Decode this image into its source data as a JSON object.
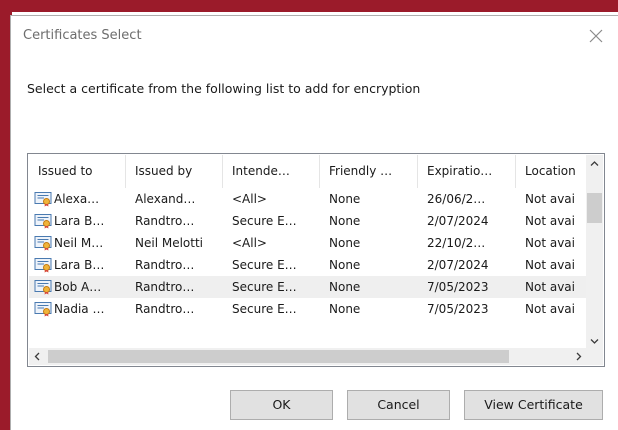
{
  "dialog": {
    "title": "Certificates Select",
    "instruction": "Select a certificate from the following list to add for encryption"
  },
  "colors": {
    "accent": "#9b1b2a",
    "selected_row": "#efefef",
    "button": "#e1e1e1"
  },
  "table": {
    "columns": [
      "Issued to",
      "Issued by",
      "Intende…",
      "Friendly …",
      "Expiratio…",
      "Location"
    ],
    "rows": [
      {
        "issued_to": "Alexa…",
        "issued_by": "Alexand…",
        "intended": "<All>",
        "friendly": "None",
        "expiration": "26/06/2…",
        "location": "Not avai"
      },
      {
        "issued_to": "Lara B…",
        "issued_by": "Randtro…",
        "intended": "Secure E…",
        "friendly": "None",
        "expiration": "2/07/2024",
        "location": "Not avai"
      },
      {
        "issued_to": "Neil M…",
        "issued_by": "Neil Melotti",
        "intended": "<All>",
        "friendly": "None",
        "expiration": "22/10/2…",
        "location": "Not avai"
      },
      {
        "issued_to": "Lara B…",
        "issued_by": "Randtro…",
        "intended": "Secure E…",
        "friendly": "None",
        "expiration": "2/07/2024",
        "location": "Not avai"
      },
      {
        "issued_to": "Bob A…",
        "issued_by": "Randtro…",
        "intended": "Secure E…",
        "friendly": "None",
        "expiration": "7/05/2023",
        "location": "Not avai"
      },
      {
        "issued_to": "Nadia …",
        "issued_by": "Randtro…",
        "intended": "Secure E…",
        "friendly": "None",
        "expiration": "7/05/2023",
        "location": "Not avai"
      }
    ],
    "selected_index": 4
  },
  "buttons": {
    "ok": "OK",
    "cancel": "Cancel",
    "view_certificate": "View Certificate"
  },
  "icons": {
    "close": "close-icon",
    "row": "certificate-icon",
    "scroll_up": "chevron-up-icon",
    "scroll_down": "chevron-down-icon",
    "scroll_left": "chevron-left-icon",
    "scroll_right": "chevron-right-icon"
  }
}
